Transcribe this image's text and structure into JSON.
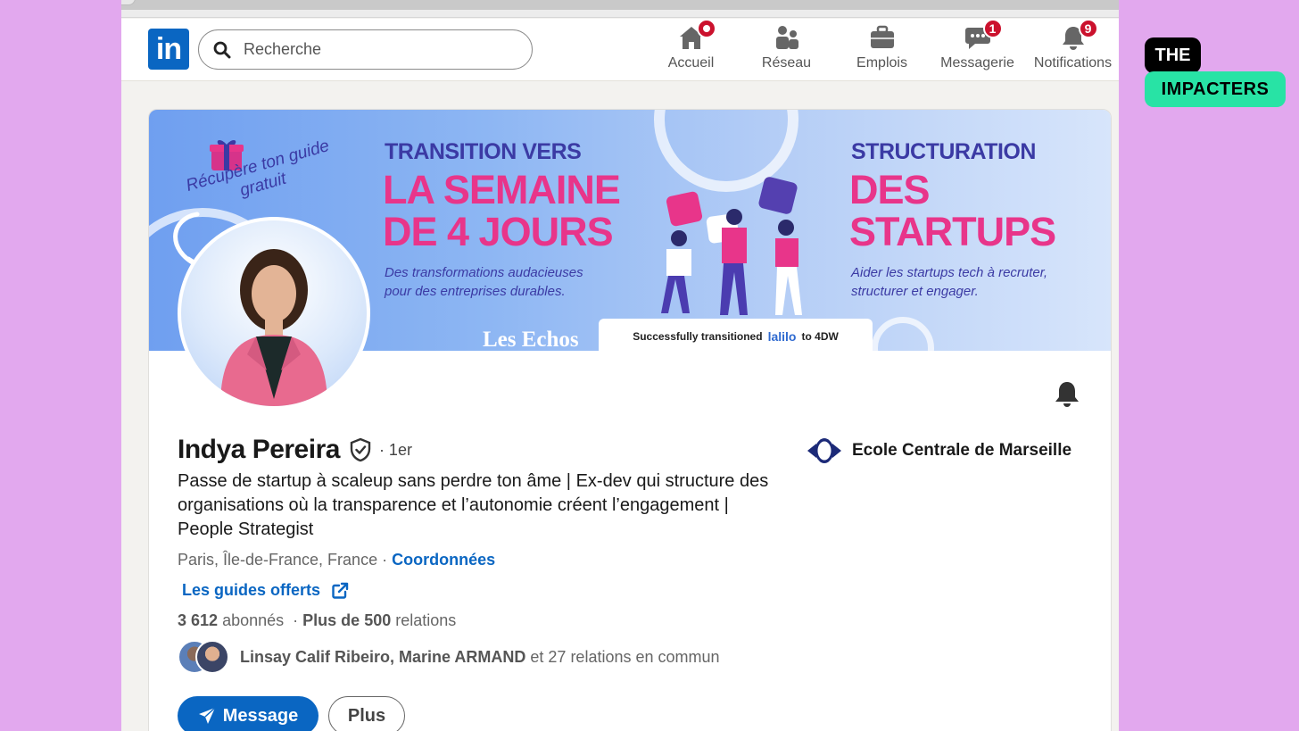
{
  "colors": {
    "page_bg": "#e2a8ee",
    "linkedin_blue": "#0a66c2",
    "badge_red": "#cb112d",
    "banner_pink": "#e8358a",
    "banner_navy": "#3b3aa4",
    "impacters_green": "#28e3a5"
  },
  "header": {
    "logo_text": "in",
    "search": {
      "placeholder": "Recherche",
      "icon": "search-icon"
    },
    "nav": [
      {
        "label": "Accueil",
        "icon": "home-icon",
        "badge": ""
      },
      {
        "label": "Réseau",
        "icon": "network-icon",
        "badge": ""
      },
      {
        "label": "Emplois",
        "icon": "briefcase-icon",
        "badge": ""
      },
      {
        "label": "Messagerie",
        "icon": "message-icon",
        "badge": "1"
      },
      {
        "label": "Notifications",
        "icon": "bell-icon",
        "badge": "9"
      }
    ]
  },
  "banner": {
    "gift_text": "Récupère ton guide gratuit",
    "left_small": "TRANSITION VERS",
    "left_big_1": "LA SEMAINE",
    "left_big_2": "DE 4 JOURS",
    "left_sub_1": "Des transformations audacieuses",
    "left_sub_2": "pour des entreprises durables.",
    "right_small": "STRUCTURATION",
    "right_big_1": "DES",
    "right_big_2": "STARTUPS",
    "right_sub_1": "Aider les startups tech à recruter,",
    "right_sub_2": "structurer et engager.",
    "press": "Les Echos",
    "pill_before": "Successfully transitioned",
    "pill_brand": "lalilo",
    "pill_after": "to 4DW"
  },
  "profile": {
    "name": "Indya Pereira",
    "degree": "· 1er",
    "headline": "Passe de startup à scaleup sans perdre ton âme | Ex-dev qui structure des organisations où la transparence et l’autonomie créent l’engagement | People Strategist",
    "location": "Paris, Île-de-France, France ·",
    "contact_link": "Coordonnées",
    "guides_link": "Les guides offerts",
    "followers_count": "3 612",
    "followers_label": "abonnés",
    "connections_prefix": "·",
    "connections_count": "Plus de 500",
    "connections_label": "relations",
    "mutual_names": "Linsay Calif Ribeiro, Marine ARMAND",
    "mutual_rest": "et 27 relations en commun",
    "education": "Ecole Centrale de Marseille",
    "message_button": "Message",
    "more_button": "Plus"
  },
  "brand_overlay": {
    "line1": "THE",
    "line2": "IMPACTERS"
  }
}
